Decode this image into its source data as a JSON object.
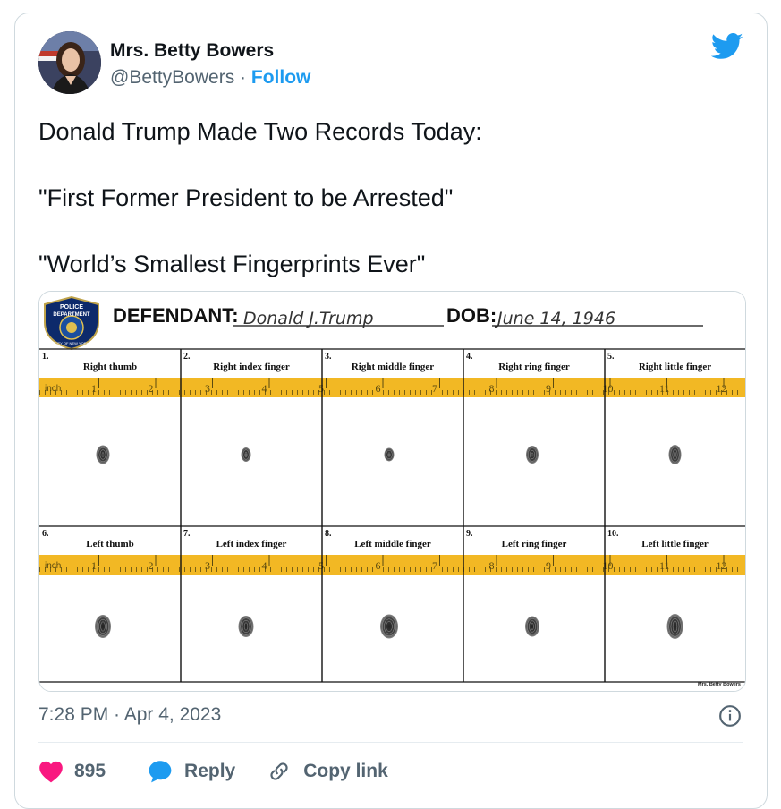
{
  "tweet": {
    "author_name": "Mrs. Betty Bowers",
    "handle": "@BettyBowers",
    "separator": " · ",
    "follow_label": "Follow",
    "paragraphs": [
      "Donald Trump Made Two Records Today:",
      "\"First Former President to be Arrested\"",
      "\"World’s Smallest Fingerprints Ever\""
    ],
    "timestamp": "7:28 PM · Apr 4, 2023",
    "likes_count": "895",
    "reply_label": "Reply",
    "copy_link_label": "Copy link",
    "colors": {
      "accent": "#1d9bf0",
      "like": "#f91880",
      "text": "#0f1419",
      "muted": "#536471"
    }
  },
  "fingerprint_card": {
    "badge_lines": [
      "POLICE",
      "DEPARTMENT",
      "CITY OF NEW YORK"
    ],
    "defendant_label": "DEFENDANT:",
    "defendant_value": "Donald J.Trump",
    "dob_label": "DOB:",
    "dob_value": "June 14, 1946",
    "ruler_unit": "inch",
    "ruler_numbers": [
      "1",
      "2",
      "3",
      "4",
      "5",
      "6",
      "7",
      "8",
      "9",
      "10",
      "11",
      "12"
    ],
    "right_hand": [
      {
        "num": "1.",
        "label": "Right thumb"
      },
      {
        "num": "2.",
        "label": "Right index finger"
      },
      {
        "num": "3.",
        "label": "Right middle finger"
      },
      {
        "num": "4.",
        "label": "Right ring finger"
      },
      {
        "num": "5.",
        "label": "Right little finger"
      }
    ],
    "left_hand": [
      {
        "num": "6.",
        "label": "Left thumb"
      },
      {
        "num": "7.",
        "label": "Left index finger"
      },
      {
        "num": "8.",
        "label": "Left middle finger"
      },
      {
        "num": "9.",
        "label": "Left ring finger"
      },
      {
        "num": "10.",
        "label": "Left little finger"
      }
    ],
    "signature": "Mrs. Betty Bowers"
  }
}
